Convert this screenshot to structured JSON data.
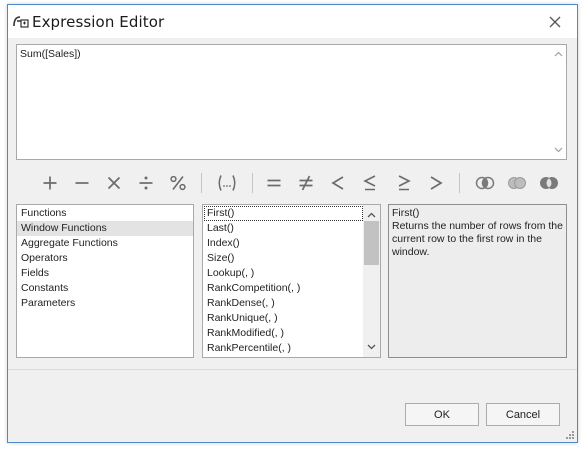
{
  "window": {
    "title": "Expression Editor"
  },
  "editor": {
    "value": "Sum([Sales])"
  },
  "operators": [
    {
      "name": "plus",
      "glyph": "+"
    },
    {
      "name": "minus",
      "glyph": "—"
    },
    {
      "name": "multiply",
      "glyph": "×"
    },
    {
      "name": "divide",
      "glyph": "÷"
    },
    {
      "name": "percent",
      "glyph": "%"
    },
    {
      "name": "parentheses",
      "glyph": "(…)"
    },
    {
      "name": "equal",
      "glyph": "="
    },
    {
      "name": "not-equal",
      "glyph": "≠"
    },
    {
      "name": "less",
      "glyph": "<"
    },
    {
      "name": "less-equal",
      "glyph": "≤"
    },
    {
      "name": "greater-equal",
      "glyph": "≥"
    },
    {
      "name": "greater",
      "glyph": ">"
    }
  ],
  "logic_icons": [
    "and-icon",
    "or-icon",
    "not-icon"
  ],
  "categories": {
    "items": [
      "Functions",
      "Window Functions",
      "Aggregate Functions",
      "Operators",
      "Fields",
      "Constants",
      "Parameters"
    ],
    "selected": "Window Functions"
  },
  "functions": {
    "items": [
      "First()",
      "Last()",
      "Index()",
      "Size()",
      "Lookup(, )",
      "RankCompetition(, )",
      "RankDense(, )",
      "RankUnique(, )",
      "RankModified(, )",
      "RankPercentile(, )"
    ],
    "focused": "First()"
  },
  "description": {
    "title": "First()",
    "text": "Returns the number of rows from the current row to the first row in the window."
  },
  "buttons": {
    "ok": "OK",
    "cancel": "Cancel"
  },
  "colors": {
    "window_border": "#4a8ac9",
    "operator_glyph": "#6b6b6b",
    "selected_item": "#e3e3e3"
  }
}
